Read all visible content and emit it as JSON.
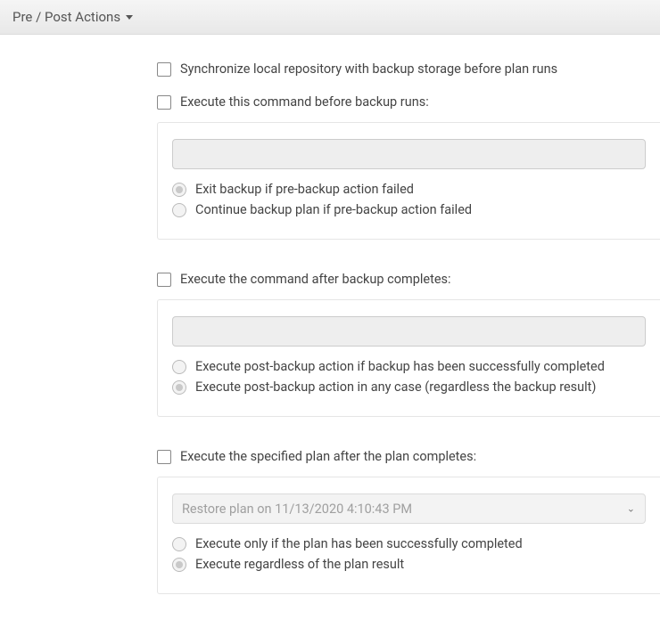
{
  "header": {
    "title": "Pre / Post Actions"
  },
  "sync": {
    "label": "Synchronize local repository with backup storage before plan runs"
  },
  "preBackup": {
    "label": "Execute this command before backup runs:",
    "command": "",
    "radio1": "Exit backup if pre-backup action failed",
    "radio2": "Continue backup plan if pre-backup action failed",
    "selected": 0
  },
  "postBackup": {
    "label": "Execute the command after backup completes:",
    "command": "",
    "radio1": "Execute post-backup action if backup has been successfully completed",
    "radio2": "Execute post-backup action in any case (regardless the backup result)",
    "selected": 1
  },
  "chainPlan": {
    "label": "Execute the specified plan after the plan completes:",
    "selectedPlan": "Restore plan on 11/13/2020 4:10:43 PM",
    "radio1": "Execute only if the plan has been successfully completed",
    "radio2": "Execute regardless of the plan result",
    "selected": 1
  }
}
